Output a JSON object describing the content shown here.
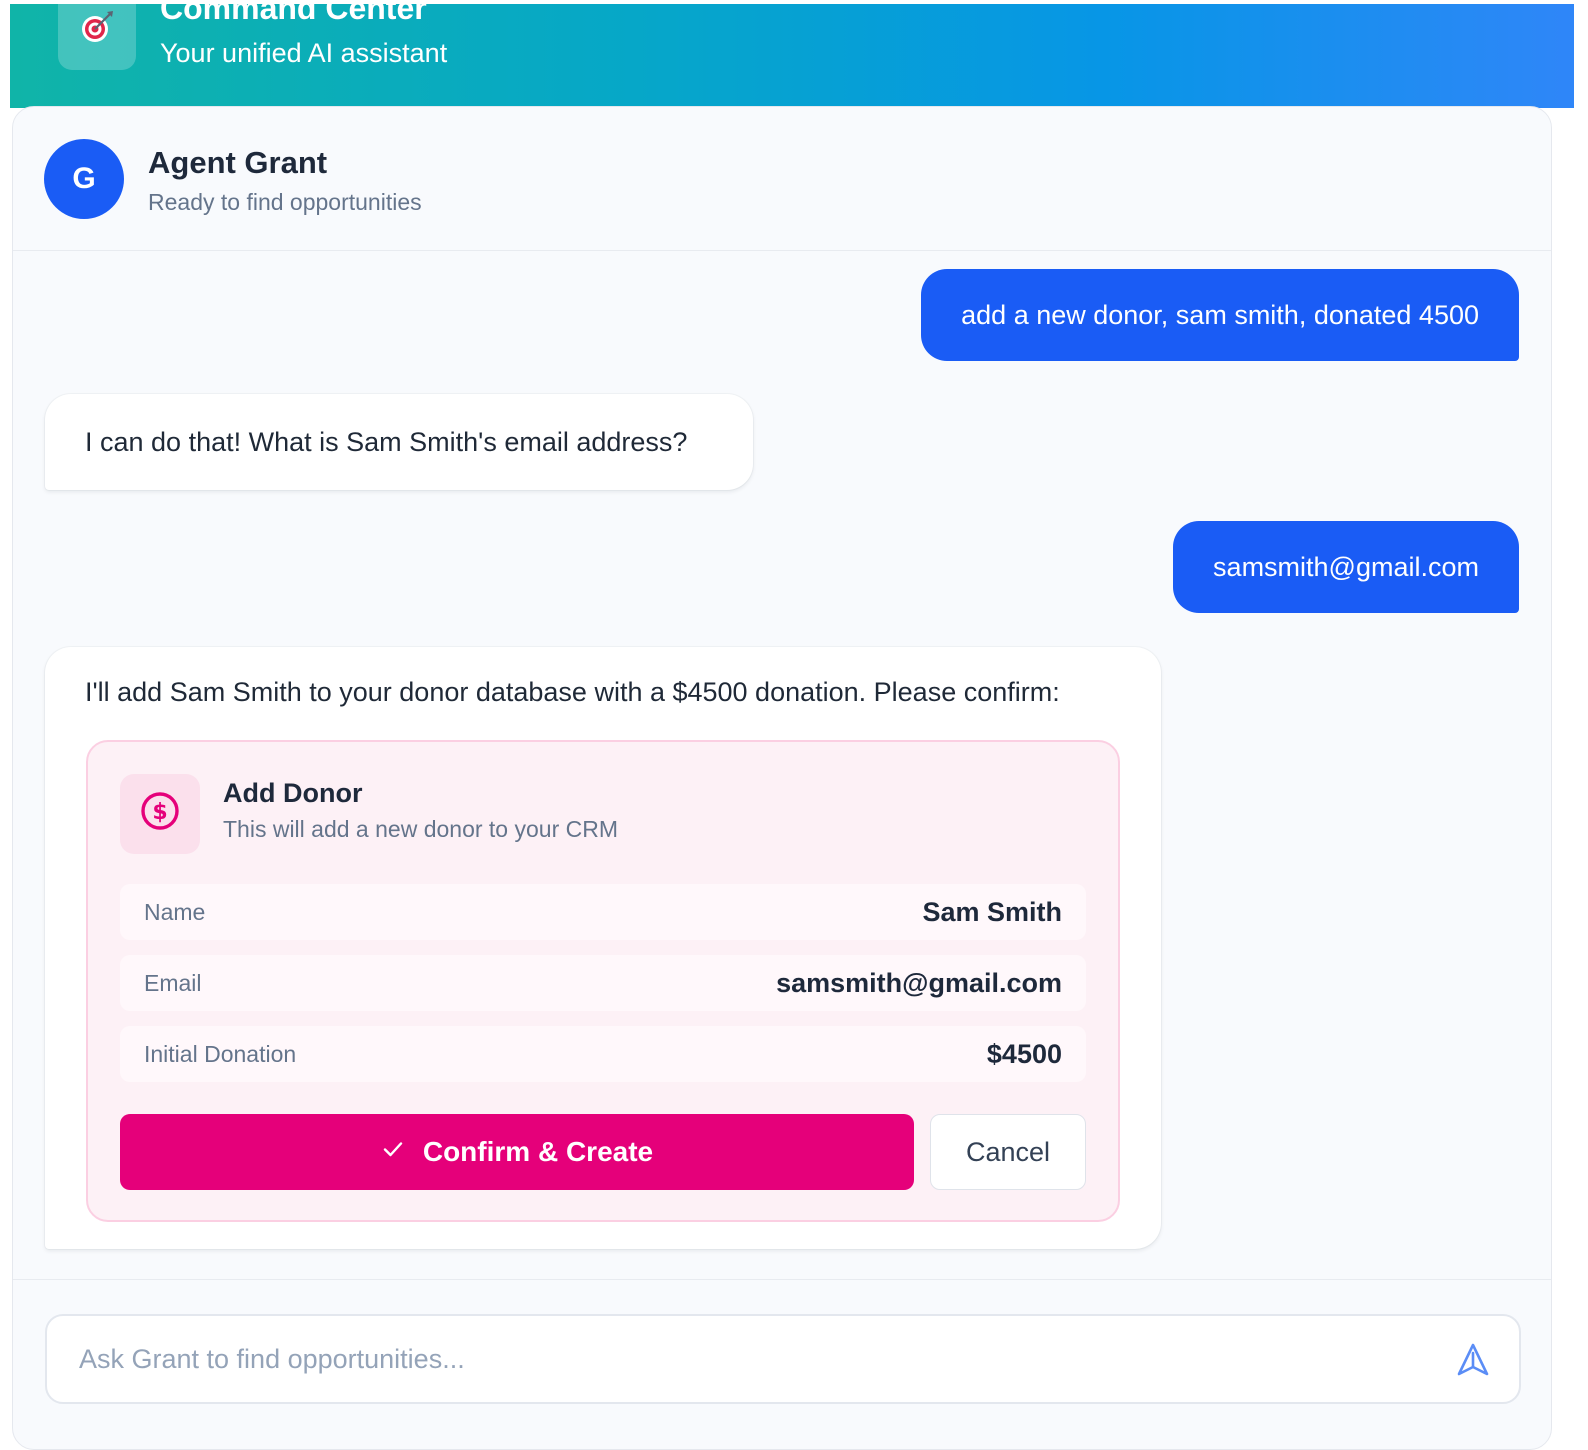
{
  "header": {
    "title": "Command Center",
    "subtitle": "Your unified AI assistant",
    "logo_icon": "target-icon"
  },
  "agent": {
    "avatar_letter": "G",
    "name": "Agent Grant",
    "status": "Ready to find opportunities"
  },
  "messages": [
    {
      "role": "user",
      "text": "add a new donor, sam smith, donated 4500"
    },
    {
      "role": "assistant",
      "text": "I can do that! What is Sam Smith's email address?"
    },
    {
      "role": "user",
      "text": "samsmith@gmail.com"
    },
    {
      "role": "assistant",
      "text": "I'll add Sam Smith to your donor database with a $4500 donation. Please confirm:"
    }
  ],
  "action_card": {
    "icon": "dollar-circle-icon",
    "title": "Add Donor",
    "subtitle": "This will add a new donor to your CRM",
    "fields": [
      {
        "label": "Name",
        "value": "Sam Smith"
      },
      {
        "label": "Email",
        "value": "samsmith@gmail.com"
      },
      {
        "label": "Initial Donation",
        "value": "$4500"
      }
    ],
    "confirm_label": "Confirm & Create",
    "cancel_label": "Cancel"
  },
  "input": {
    "placeholder": "Ask Grant to find opportunities...",
    "value": "",
    "send_icon": "send-icon"
  },
  "colors": {
    "accent_blue": "#1a5cf5",
    "accent_pink": "#e5007a",
    "header_gradient_start": "#10b4a8",
    "header_gradient_end": "#2f86f8"
  }
}
